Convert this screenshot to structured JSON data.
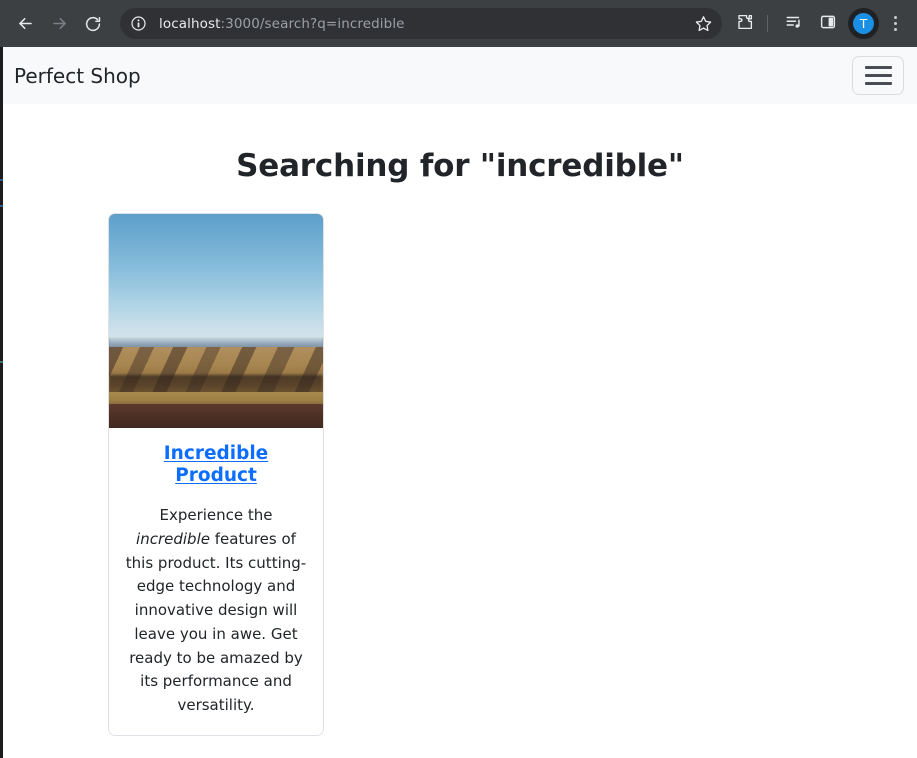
{
  "browser": {
    "back_icon": "back-arrow-icon",
    "forward_icon": "forward-arrow-icon",
    "reload_icon": "reload-icon",
    "site_info_icon": "site-info-circle-icon",
    "url_host": "localhost",
    "url_rest": ":3000/search?q=incredible",
    "bookmark_icon": "star-icon",
    "extensions_icon": "puzzle-piece-icon",
    "media_icon": "media-playlist-icon",
    "side_panel_icon": "side-panel-icon",
    "avatar_initial": "T",
    "menu_icon": "three-dot-menu-icon",
    "accent_avatar_color": "#1a8fe3",
    "chrome_background": "#3c4043",
    "omnibox_background": "#303134"
  },
  "navbar": {
    "brand": "Perfect Shop",
    "toggler_icon": "hamburger-menu-icon",
    "background": "#f8f9fa"
  },
  "main": {
    "page_title": "Searching for \"incredible\"",
    "results": [
      {
        "image_alt": "landscape-photo",
        "title": "Incredible Product",
        "title_color": "#0d6efd",
        "description_before": "Experience the ",
        "description_highlight": "incredible",
        "description_after": " features of this product. Its cutting-edge technology and innovative design will leave you in awe. Get ready to be amazed by its performance and versatility."
      }
    ]
  }
}
